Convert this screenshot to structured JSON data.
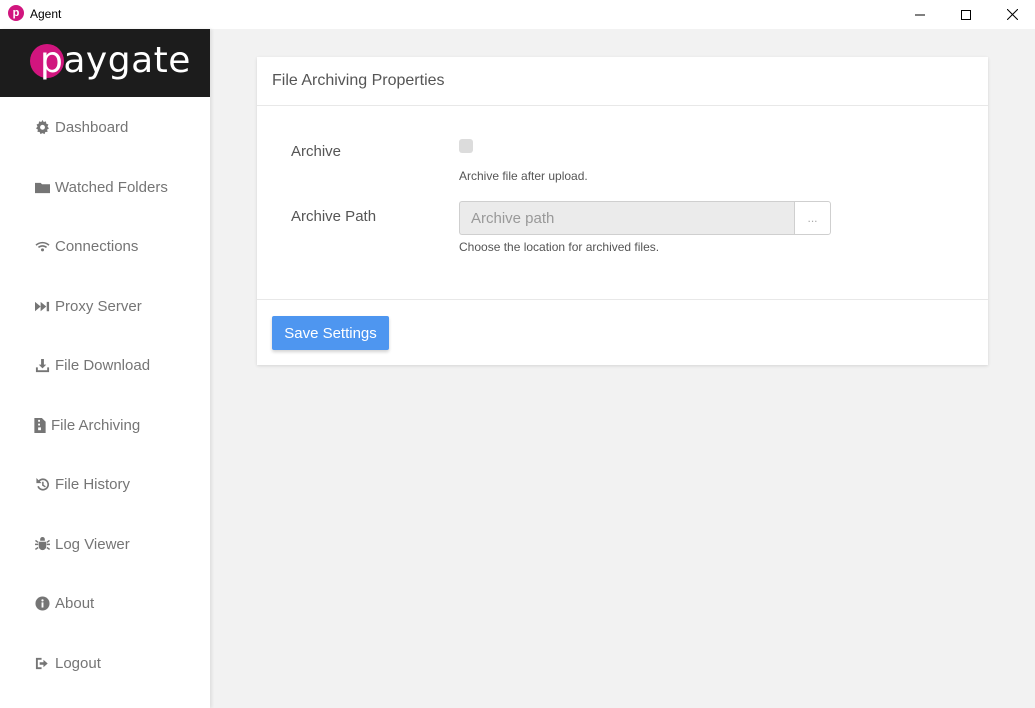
{
  "window": {
    "title": "Agent",
    "app_icon_glyph": "p"
  },
  "brand": {
    "logo_text": "paygate",
    "accent": "#d1157e"
  },
  "sidebar": {
    "items": [
      {
        "label": "Dashboard",
        "icon": "gear-icon"
      },
      {
        "label": "Watched Folders",
        "icon": "folder-icon"
      },
      {
        "label": "Connections",
        "icon": "wifi-icon"
      },
      {
        "label": "Proxy Server",
        "icon": "fast-forward-icon"
      },
      {
        "label": "File Download",
        "icon": "download-icon"
      },
      {
        "label": "File Archiving",
        "icon": "archive-file-icon"
      },
      {
        "label": "File History",
        "icon": "history-icon"
      },
      {
        "label": "Log Viewer",
        "icon": "bug-icon"
      },
      {
        "label": "About",
        "icon": "info-icon"
      },
      {
        "label": "Logout",
        "icon": "logout-icon"
      }
    ]
  },
  "card": {
    "title": "File Archiving Properties",
    "archive": {
      "label": "Archive",
      "help": "Archive file after upload.",
      "checked": false
    },
    "archive_path": {
      "label": "Archive Path",
      "value": "",
      "placeholder": "Archive path",
      "browse_label": "...",
      "help": "Choose the location for archived files."
    },
    "save_label": "Save Settings"
  },
  "colors": {
    "primary_button": "#4e96f0",
    "sidebar_text": "#757575"
  }
}
